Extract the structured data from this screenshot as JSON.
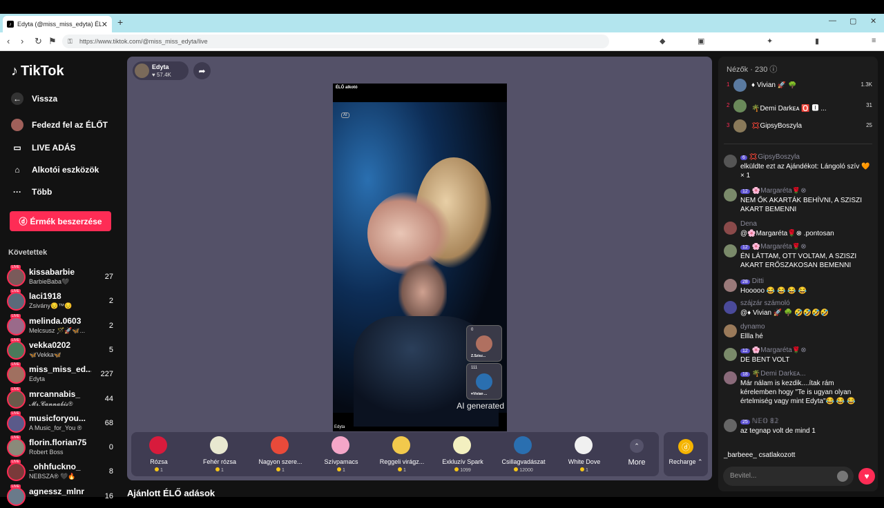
{
  "browser": {
    "tab_title": "Edyta (@miss_miss_edyta) ÉL",
    "url": "https://www.tiktok.com/@miss_miss_edyta/live",
    "new_tab": "+"
  },
  "sidebar": {
    "logo": "TikTok",
    "nav": [
      {
        "label": "Vissza",
        "icon": "back-arrow-icon"
      },
      {
        "label": "Fedezd fel az ÉLŐT",
        "icon": "avatar"
      },
      {
        "label": "LIVE ADÁS",
        "icon": "camera-icon"
      },
      {
        "label": "Alkotói eszközök",
        "icon": "creator-icon"
      },
      {
        "label": "Több",
        "icon": "more-icon"
      }
    ],
    "buy_button": "Érmék beszerzése",
    "following_title": "Követettek",
    "following": [
      {
        "name": "kissabarbie",
        "sub": "BarbieBaba🖤",
        "count": "27"
      },
      {
        "name": "laci1918",
        "sub": "Zsivány😔™😔",
        "count": "2"
      },
      {
        "name": "melinda.0603",
        "sub": "Melcsusz 🪄🚀🦋...",
        "count": "2"
      },
      {
        "name": "vekka0202",
        "sub": "🦋Vekka🦋",
        "count": "5"
      },
      {
        "name": "miss_miss_ed...",
        "sub": "Edyta",
        "count": "227"
      },
      {
        "name": "mrcannabis_",
        "sub": "𝓜𝓻.𝓒𝓪𝓷𝓷𝓪𝓫𝓲𝓼®",
        "count": "44"
      },
      {
        "name": "musicforyou...",
        "sub": "A Music_for_You ®",
        "count": "68"
      },
      {
        "name": "florin.florian75",
        "sub": "Robert Boss",
        "count": "0"
      },
      {
        "name": "_ohhfuckno_",
        "sub": "NEBSZA® 🖤🔥",
        "count": "8"
      },
      {
        "name": "agnessz_mlnr",
        "sub": "",
        "count": "16"
      }
    ]
  },
  "live": {
    "host_name": "Edyta",
    "host_likes": "♥ 57.4K",
    "video_tag": "ÉLŐ alkotó",
    "ai_label": "AI",
    "video_footer": "Edyta",
    "ai_generated": "AI generated",
    "pips": [
      {
        "count": "0",
        "name": "Z.Szisz..."
      },
      {
        "count": "111",
        "name": "♥Vivian ..."
      }
    ]
  },
  "gifts": [
    {
      "name": "Rózsa",
      "price": "1",
      "color": "#d81b3c"
    },
    {
      "name": "Fehér rózsa",
      "price": "1",
      "color": "#e8e8d0"
    },
    {
      "name": "Nagyon szere...",
      "price": "1",
      "color": "#e84a3a"
    },
    {
      "name": "Szívpamacs",
      "price": "1",
      "color": "#f4a6c8"
    },
    {
      "name": "Reggeli virágz...",
      "price": "1",
      "color": "#f2c94c"
    },
    {
      "name": "Exkluzív Spark",
      "price": "1099",
      "color": "#f3f0c0"
    },
    {
      "name": "Csillagvadászat",
      "price": "12000",
      "color": "#2a6fb0"
    },
    {
      "name": "White Dove",
      "price": "1",
      "color": "#f0f0f0"
    }
  ],
  "more_label": "More",
  "recharge_label": "Recharge ⌃",
  "recommended": "Ajánlott ÉLŐ adások",
  "chat": {
    "viewers_title": "Nézők",
    "viewers_count": "· 230 ⓘ",
    "top": [
      {
        "rank": "1",
        "name": "♦ Vivian 🚀 🌳",
        "count": "1.3K"
      },
      {
        "rank": "2",
        "name": "🌴Demi Darkᴇᴀ 🅾️ 🅸 ...",
        "count": "31"
      },
      {
        "rank": "3",
        "name": "💢GipsyBoszyla",
        "count": "25"
      }
    ],
    "messages": [
      {
        "user": "💢GipsyBoszyla",
        "badge": "6",
        "text": "elküldte ezt az Ajándékot: Lángoló szív 🧡 × 1"
      },
      {
        "user": "🌸Margaréta🌹⊗",
        "badge": "12",
        "text": "NEM ŐK AKARTÁK BEHÍVNI, A SZISZI AKART BEMENNI"
      },
      {
        "user": "Dena",
        "badge": "",
        "text": "@🌸Margaréta🌹⊗ .pontosan"
      },
      {
        "user": "🌸Margaréta🌹⊗",
        "badge": "12",
        "text": "ÉN LÁTTAM, OTT VOLTAM, A SZISZI AKART ERŐSZAKOSAN BEMENNI"
      },
      {
        "user": "Ditti",
        "badge": "28",
        "text": "Hooooo 😂 😂 😂 😂"
      },
      {
        "user": "szájzár számoló",
        "badge": "",
        "text": "@♦ Vivian 🚀 🌳 🤣🤣🤣🤣"
      },
      {
        "user": "dynamo",
        "badge": "",
        "text": "Ellla hé"
      },
      {
        "user": "🌸Margaréta🌹⊗",
        "badge": "12",
        "text": "DE BENT VOLT"
      },
      {
        "user": "🌴Demi Darkᴇᴀ...",
        "badge": "18",
        "text": "Már nálam is kezdik....ítak rám kérelemben hogy \"Te is ugyan olyan értelmiség vagy mint Edyta\"😂 😂 😂"
      },
      {
        "user": "ℕ𝔼𝕆 𝟠𝟚",
        "badge": "25",
        "text": "az tegnap volt de mind 1"
      }
    ],
    "joined": "_barbeee_ csatlakozott",
    "input_placeholder": "Bevitel..."
  }
}
